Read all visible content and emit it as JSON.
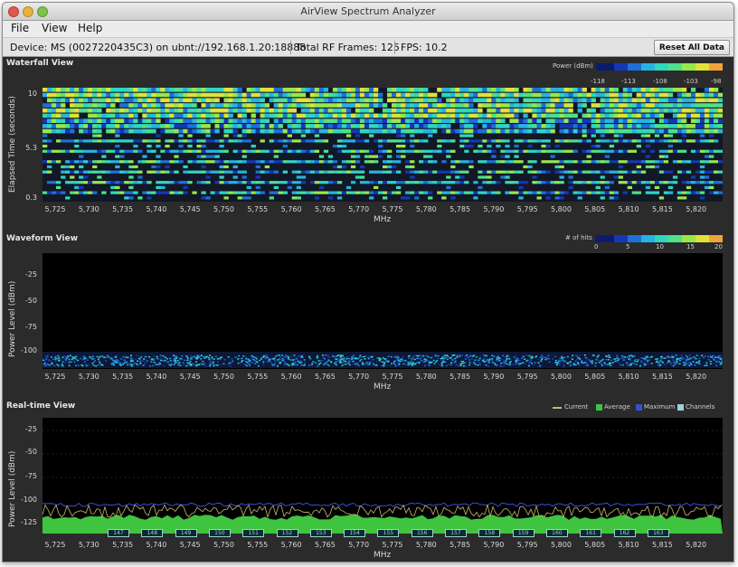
{
  "window": {
    "title": "AirView Spectrum Analyzer"
  },
  "menu": {
    "items": [
      "File",
      "View",
      "Help"
    ]
  },
  "toolbar": {
    "device": "Device: MS (0027220435C3) on ubnt://192.168.1.20:18888",
    "frames": "Total RF Frames: 125",
    "fps": "FPS: 10.2",
    "reset_label": "Reset All Data"
  },
  "x_ticks": [
    "5,725",
    "5,730",
    "5,735",
    "5,740",
    "5,745",
    "5,750",
    "5,755",
    "5,760",
    "5,765",
    "5,770",
    "5,775",
    "5,780",
    "5,785",
    "5,790",
    "5,795",
    "5,800",
    "5,805",
    "5,810",
    "5,815",
    "5,820"
  ],
  "waterfall": {
    "title": "Waterfall View",
    "ylabel": "Elapsed Time (seconds)",
    "yticks": [
      "10",
      "5.3",
      "0.3"
    ],
    "xlabel": "MHz",
    "legend_title": "Power (dBm)",
    "legend_ticks": [
      "-118",
      "-113",
      "-108",
      "-103",
      "-98"
    ]
  },
  "waveform": {
    "title": "Waveform View",
    "ylabel": "Power Level (dBm)",
    "yticks": [
      "-25",
      "-50",
      "-75",
      "-100"
    ],
    "xlabel": "MHz",
    "legend_title": "# of hits",
    "legend_ticks": [
      "0",
      "5",
      "10",
      "15",
      "20"
    ]
  },
  "realtime": {
    "title": "Real-time View",
    "ylabel": "Power Level (dBm)",
    "yticks": [
      "-25",
      "-50",
      "-75",
      "-100",
      "-125"
    ],
    "xlabel": "MHz",
    "legend": [
      "Current",
      "Average",
      "Maximum",
      "Channels"
    ],
    "channels": [
      "147",
      "148",
      "149",
      "150",
      "151",
      "152",
      "153",
      "154",
      "155",
      "156",
      "157",
      "158",
      "159",
      "160",
      "161",
      "162",
      "163"
    ]
  },
  "colors": {
    "current": "#c9b86a",
    "average": "#3fc43f",
    "maximum": "#3a4fd0",
    "channel": "#9fcfd0"
  }
}
